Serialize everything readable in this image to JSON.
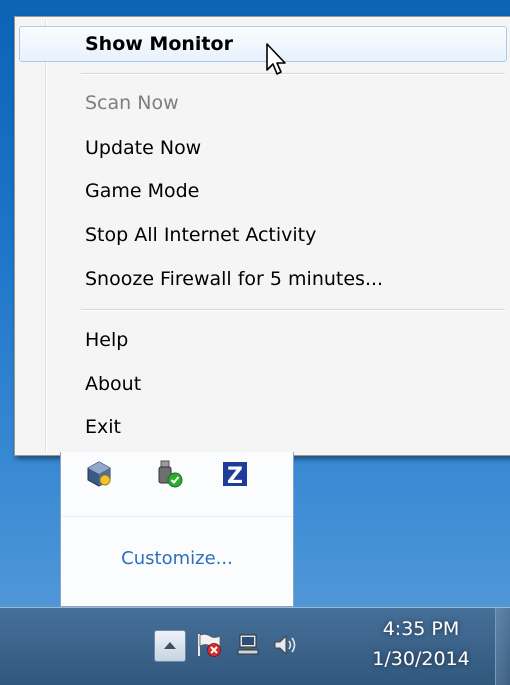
{
  "menu": {
    "items": [
      {
        "label": "Show Monitor",
        "state": "default-hover"
      },
      {
        "label": "Scan Now",
        "state": "disabled"
      },
      {
        "label": "Update Now",
        "state": "normal"
      },
      {
        "label": "Game Mode",
        "state": "normal"
      },
      {
        "label": "Stop All Internet Activity",
        "state": "normal"
      },
      {
        "label": "Snooze Firewall for 5 minutes...",
        "state": "normal"
      },
      {
        "label": "Help",
        "state": "normal"
      },
      {
        "label": "About",
        "state": "normal"
      },
      {
        "label": "Exit",
        "state": "normal"
      }
    ]
  },
  "flyout": {
    "icons": [
      "virtualbox-icon",
      "usb-safely-remove-icon",
      "zonealarm-z-icon"
    ],
    "customize_label": "Customize...",
    "z_letter": "Z"
  },
  "taskbar": {
    "tray_icons": [
      "show-hidden-icons-icon",
      "action-center-flag-icon",
      "network-icon",
      "volume-icon"
    ],
    "clock_time": "4:35 PM",
    "clock_date": "1/30/2014"
  },
  "colors": {
    "link": "#2d6ebd",
    "hover_border": "#a8cbf1",
    "disabled_text": "#7e7e7e",
    "zonealarm_blue": "#1f3c9a"
  }
}
